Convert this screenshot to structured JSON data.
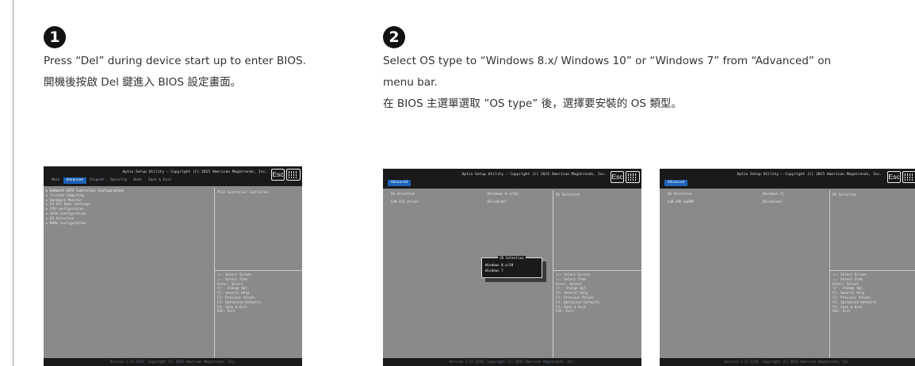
{
  "steps": [
    {
      "number": "1",
      "text_en": "Press “Del” during device start up to enter BIOS.",
      "text_zh": "開機後按啟 Del 鍵進入 BIOS 設定畫面。"
    },
    {
      "number": "2",
      "text_en_line1": "Select OS type to “Windows 8.x/ Windows 10” or “Windows 7” from “Advanced” on",
      "text_en_line2": "menu bar.",
      "text_zh": "在 BIOS 主選單選取 ”OS type” 後，選擇要安裝的 OS 類型。"
    }
  ],
  "bios_common": {
    "title": "Aptio Setup Utility – Copyright (C) 2015 American Megatrends, Inc.",
    "esc_label": "Esc",
    "keyboard_icon": "keyboard-icon",
    "footer": "Version 2.17.1254. Copyright (C) 2015 American Megatrends, Inc.",
    "help_lines": [
      "→←: Select Screen",
      "↑↓: Select Item",
      "Enter: Select",
      "+/-: Change Opt.",
      "F1: General Help",
      "F2: Previous Values",
      "F3: Optimized Defaults",
      "F4: Save & Exit",
      "ESC: Exit"
    ]
  },
  "screen1": {
    "menu": [
      "Main",
      "Advanced",
      "Chipset",
      "Security",
      "Boot",
      "Save & Exit"
    ],
    "active_menu": "Advanced",
    "items": [
      "OnBoard SATA Controller Configuration",
      "Trusted Computing",
      "Hardware Monitor",
      "S5 RTC Wake Settings",
      "CPU Configuration",
      "SATA Configuration",
      "OS Selection",
      "NVMe Configuration"
    ],
    "description": "PCIe Controller Controller"
  },
  "screen2": {
    "tab": "Advanced",
    "rows": [
      {
        "label": "OS Selection",
        "value": "[Windows 8.x/10]"
      },
      {
        "label": "LAN EFI driver",
        "value": "[Disabled]"
      }
    ],
    "description": "OS Selection",
    "popup": {
      "title": "OS Selection",
      "options": [
        "Windows 8.x/10",
        "Windows 7"
      ]
    }
  },
  "screen3": {
    "tab": "Advanced",
    "rows": [
      {
        "label": "OS Selection",
        "value": "[Windows 7]"
      },
      {
        "label": "LAN PXE OpROM",
        "value": "[Disabled]"
      }
    ],
    "description": "OS Selection"
  },
  "colors": {
    "bios_bg": "#8a8a8a",
    "bios_bar": "#1a1a1a",
    "menu_active": "#1e63b6",
    "step_circle": "#111111"
  }
}
